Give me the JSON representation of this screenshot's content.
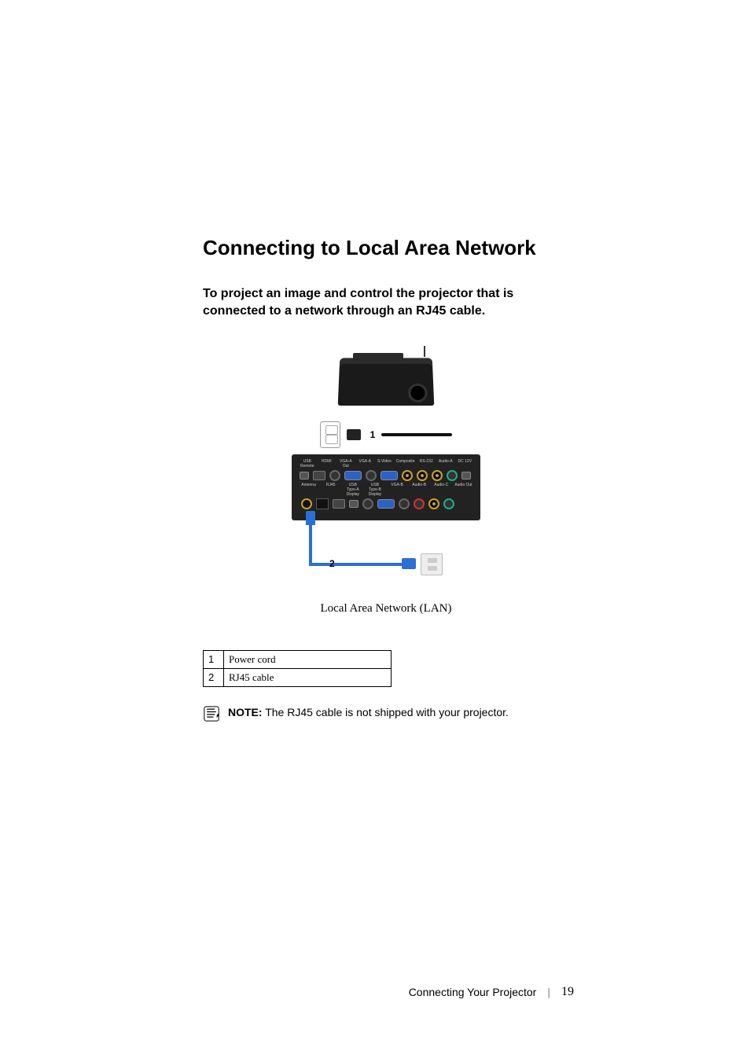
{
  "heading": "Connecting to Local Area Network",
  "subheading": "To project an image and control the projector that is connected to a network through an RJ45 cable.",
  "figure": {
    "callout_1": "1",
    "callout_2": "2",
    "caption": "Local Area Network (LAN)",
    "ports": {
      "row1_labels": [
        "USB Remote",
        "HDMI",
        "VGA-A Out",
        "VGA-A",
        "S-Video",
        "Composite",
        "RS-232",
        "Audio-A",
        "DC 12V"
      ],
      "row2_labels": [
        "Antenna",
        "RJ45",
        "USB Type-A Display",
        "USB Type-B Display",
        "VGA-B",
        "Audio-B",
        "Audio-C",
        "Audio Out"
      ]
    }
  },
  "legend": [
    {
      "num": "1",
      "desc": "Power cord"
    },
    {
      "num": "2",
      "desc": "RJ45 cable"
    }
  ],
  "note": {
    "label": "NOTE:",
    "text": " The RJ45 cable is not shipped with your projector."
  },
  "footer": {
    "section": "Connecting Your Projector",
    "page": "19"
  }
}
